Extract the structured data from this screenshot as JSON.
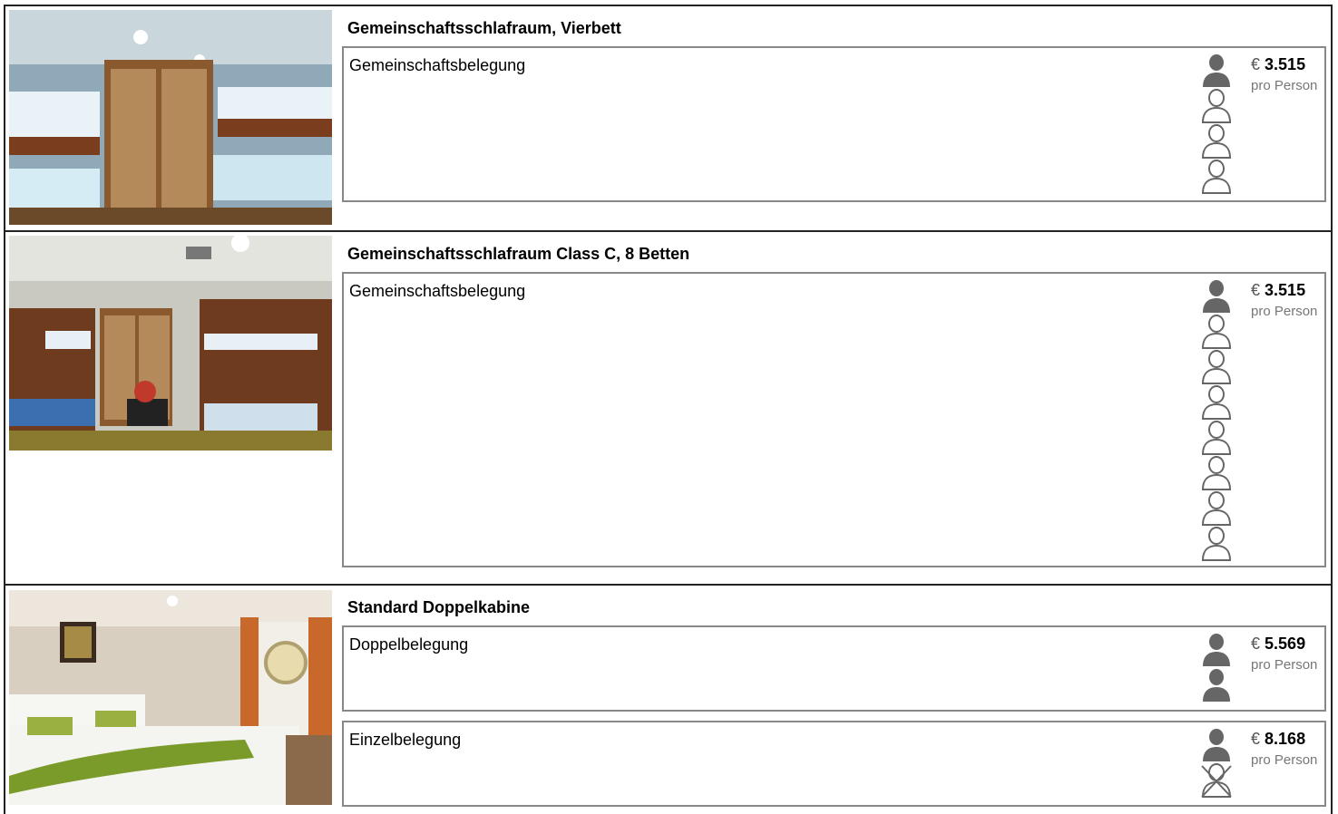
{
  "colors": {
    "border_outer": "#222222",
    "border_inner": "#888888",
    "person_icon": "#666666",
    "price_sub": "#777777"
  },
  "cabins": [
    {
      "title": "Gemeinschaftsschlafraum, Vierbett",
      "image": "bunk-room-photo",
      "occupancies": [
        {
          "label": "Gemeinschaftsbelegung",
          "currency": "€",
          "price": "3.515",
          "per": "pro Person",
          "persons": [
            "filled",
            "outline",
            "outline",
            "outline"
          ]
        }
      ]
    },
    {
      "title": "Gemeinschaftsschlafraum Class C, 8 Betten",
      "image": "dormitory-photo",
      "occupancies": [
        {
          "label": "Gemeinschaftsbelegung",
          "currency": "€",
          "price": "3.515",
          "per": "pro Person",
          "persons": [
            "filled",
            "outline",
            "outline",
            "outline",
            "outline",
            "outline",
            "outline",
            "outline"
          ]
        }
      ]
    },
    {
      "title": "Standard Doppelkabine",
      "image": "double-cabin-photo",
      "occupancies": [
        {
          "label": "Doppelbelegung",
          "currency": "€",
          "price": "5.569",
          "per": "pro Person",
          "persons": [
            "filled",
            "filled"
          ]
        },
        {
          "label": "Einzelbelegung",
          "currency": "€",
          "price": "8.168",
          "per": "pro Person",
          "persons": [
            "filled",
            "crossed"
          ]
        }
      ]
    }
  ]
}
